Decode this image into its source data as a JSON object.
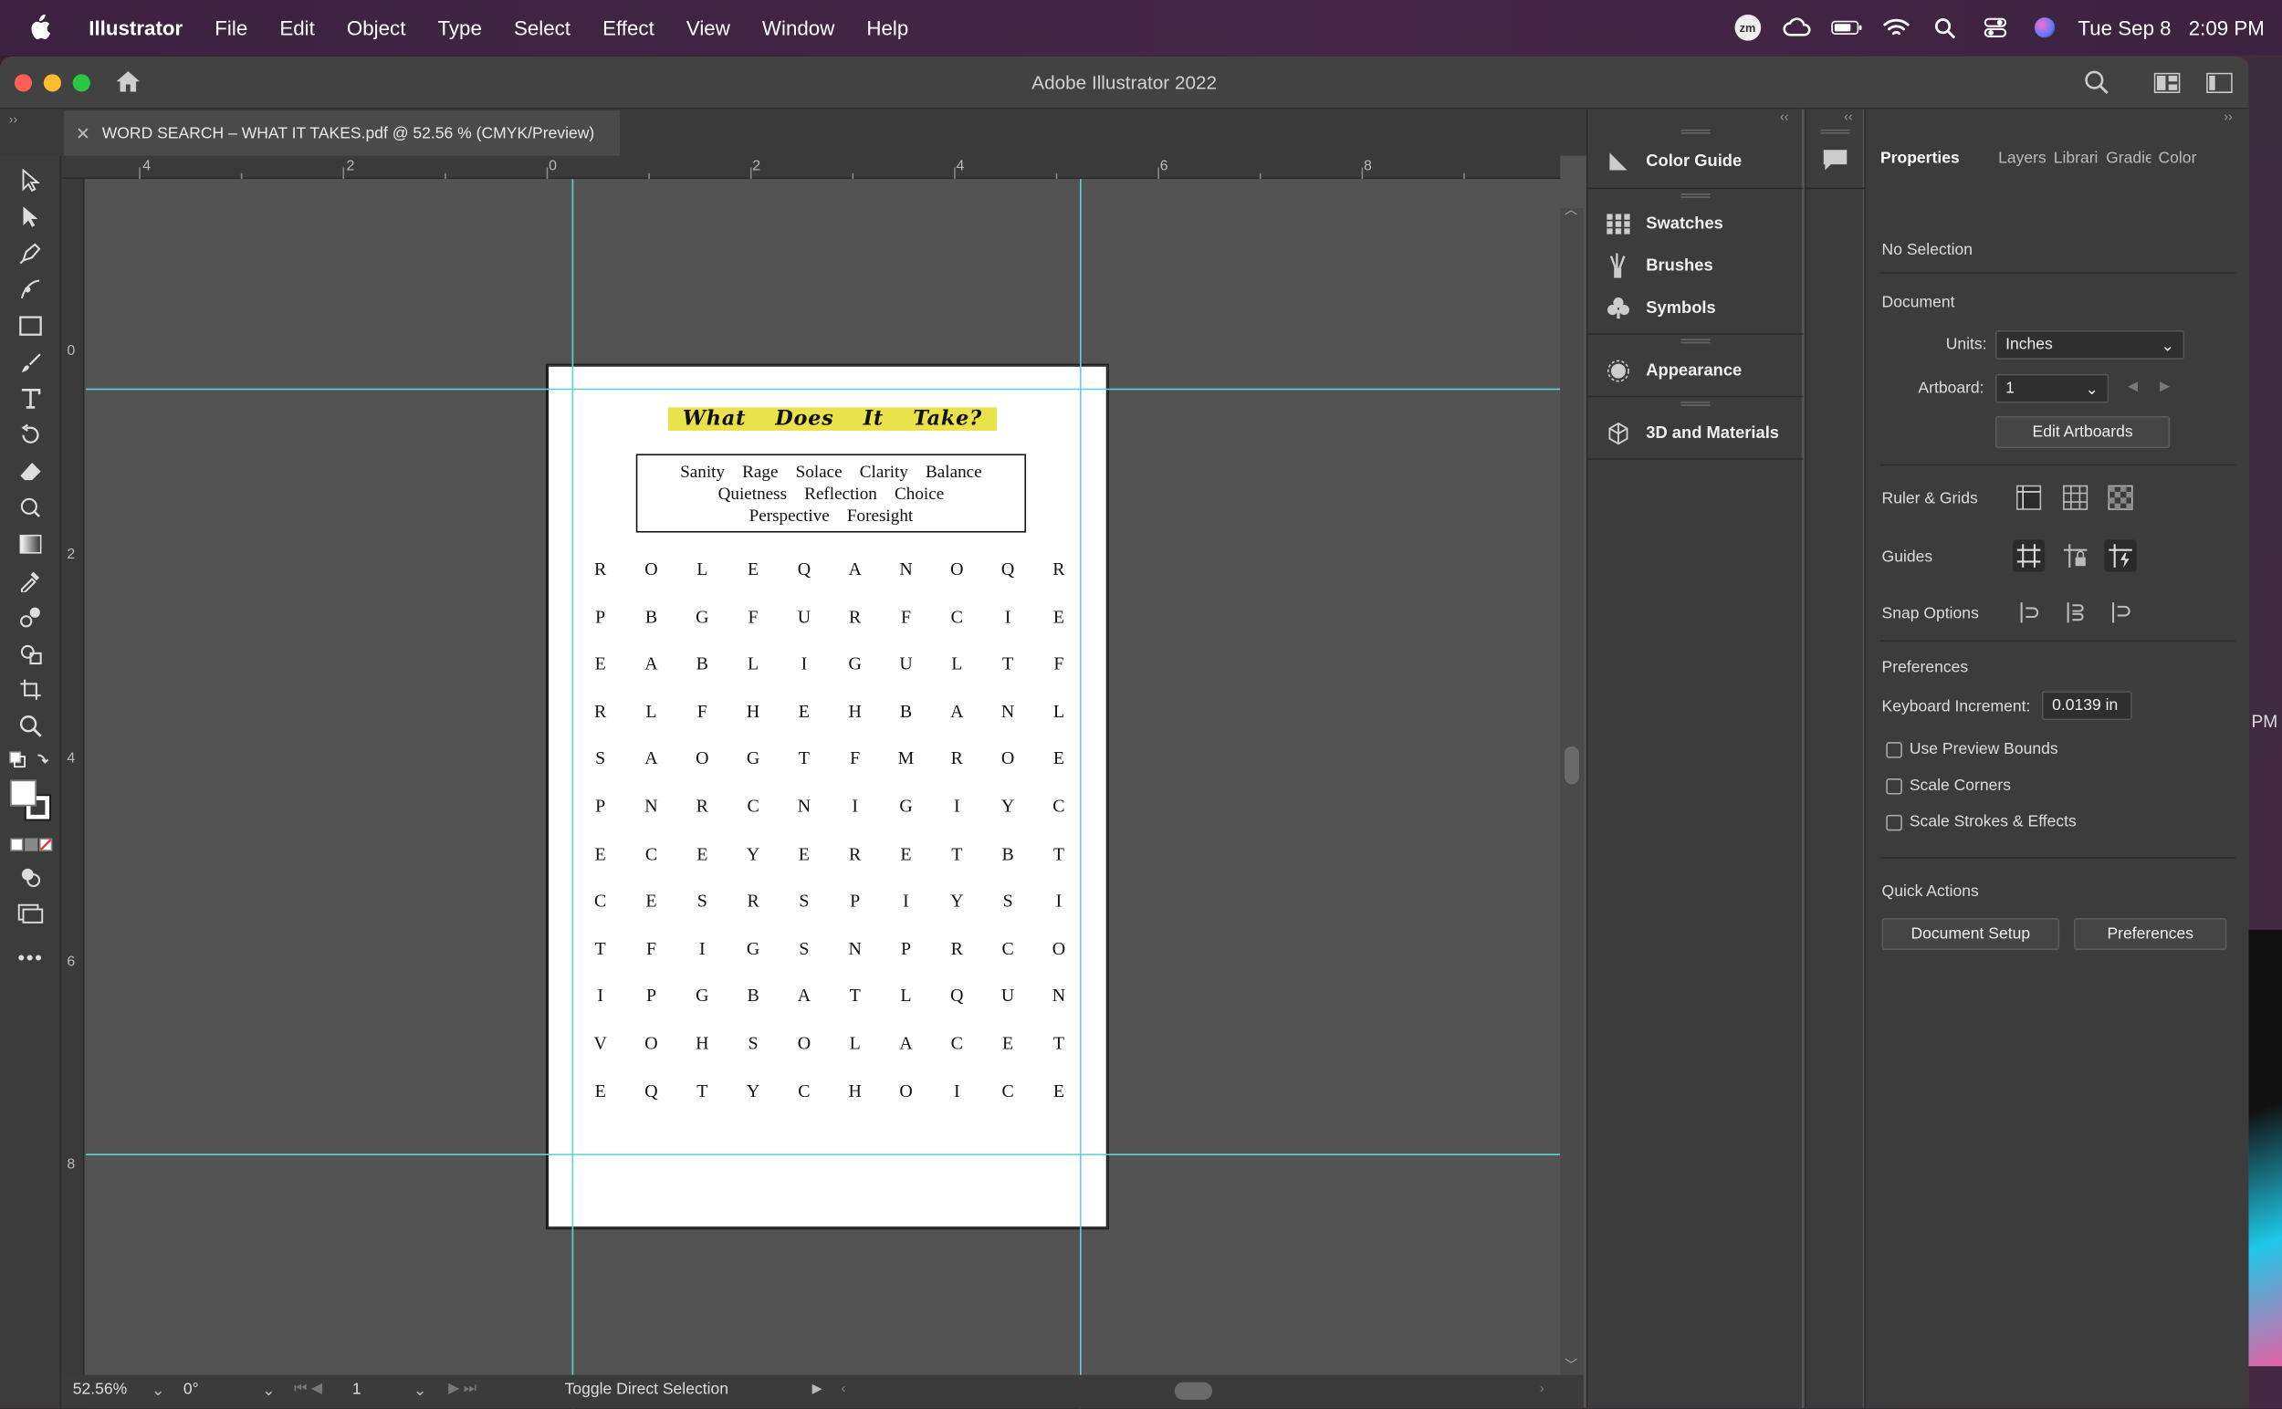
{
  "menubar": {
    "app": "Illustrator",
    "items": [
      "File",
      "Edit",
      "Object",
      "Type",
      "Select",
      "Effect",
      "View",
      "Window",
      "Help"
    ],
    "zoom_badge": "zm",
    "date": "Tue Sep 8",
    "time": "2:09 PM"
  },
  "window": {
    "title": "Adobe Illustrator 2022",
    "doc_tab": "WORD SEARCH – WHAT IT TAKES.pdf @ 52.56 % (CMYK/Preview)"
  },
  "ruler": {
    "h_labels": [
      "4",
      "2",
      "0",
      "2",
      "4",
      "6",
      "8"
    ],
    "v_labels": [
      "0",
      "2",
      "4",
      "6",
      "8"
    ]
  },
  "artwork": {
    "title_words": [
      "What",
      "Does",
      "It",
      "Take?"
    ],
    "word_lines": [
      [
        "Sanity",
        "Rage",
        "Solace",
        "Clarity",
        "Balance"
      ],
      [
        "Quietness",
        "Reflection",
        "Choice"
      ],
      [
        "Perspective",
        "Foresight"
      ]
    ],
    "grid": [
      [
        "R",
        "O",
        "L",
        "E",
        "Q",
        "A",
        "N",
        "O",
        "Q",
        "R"
      ],
      [
        "P",
        "B",
        "G",
        "F",
        "U",
        "R",
        "F",
        "C",
        "I",
        "E"
      ],
      [
        "E",
        "A",
        "B",
        "L",
        "I",
        "G",
        "U",
        "L",
        "T",
        "F"
      ],
      [
        "R",
        "L",
        "F",
        "H",
        "E",
        "H",
        "B",
        "A",
        "N",
        "L"
      ],
      [
        "S",
        "A",
        "O",
        "G",
        "T",
        "F",
        "M",
        "R",
        "O",
        "E"
      ],
      [
        "P",
        "N",
        "R",
        "C",
        "N",
        "I",
        "G",
        "I",
        "Y",
        "C"
      ],
      [
        "E",
        "C",
        "E",
        "Y",
        "E",
        "R",
        "E",
        "T",
        "B",
        "T"
      ],
      [
        "C",
        "E",
        "S",
        "R",
        "S",
        "P",
        "I",
        "Y",
        "S",
        "I"
      ],
      [
        "T",
        "F",
        "I",
        "G",
        "S",
        "N",
        "P",
        "R",
        "C",
        "O"
      ],
      [
        "I",
        "P",
        "G",
        "B",
        "A",
        "T",
        "L",
        "Q",
        "U",
        "N"
      ],
      [
        "V",
        "O",
        "H",
        "S",
        "O",
        "L",
        "A",
        "C",
        "E",
        "T"
      ],
      [
        "E",
        "Q",
        "T",
        "Y",
        "C",
        "H",
        "O",
        "I",
        "C",
        "E"
      ]
    ]
  },
  "statusbar": {
    "zoom": "52.56%",
    "rotation": "0°",
    "artboard": "1",
    "tool_hint": "Toggle Direct Selection"
  },
  "panels": {
    "collapsed": [
      "Color Guide",
      "Swatches",
      "Brushes",
      "Symbols",
      "Appearance",
      "3D and Materials"
    ]
  },
  "properties": {
    "tabs": [
      "Properties",
      "Layers",
      "Libraries",
      "Gradient",
      "Color"
    ],
    "selection": "No Selection",
    "document_header": "Document",
    "units_label": "Units:",
    "units_value": "Inches",
    "artboard_label": "Artboard:",
    "artboard_value": "1",
    "edit_artboards": "Edit Artboards",
    "ruler_grids": "Ruler & Grids",
    "guides": "Guides",
    "snap_options": "Snap Options",
    "preferences_header": "Preferences",
    "keyboard_increment_label": "Keyboard Increment:",
    "keyboard_increment_value": "0.0139 in",
    "use_preview_bounds": "Use Preview Bounds",
    "scale_corners": "Scale Corners",
    "scale_strokes": "Scale Strokes & Effects",
    "quick_actions": "Quick Actions",
    "document_setup": "Document Setup",
    "preferences_btn": "Preferences"
  },
  "desktop": {
    "edge_text": "PM"
  }
}
